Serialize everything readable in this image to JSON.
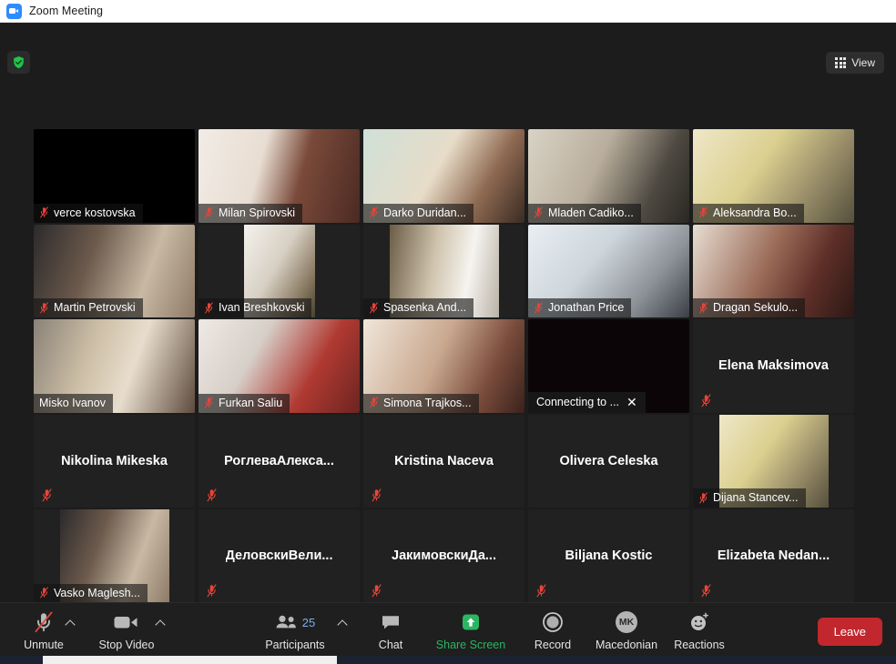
{
  "titlebar": {
    "title": "Zoom Meeting",
    "icon": "zoom-logo-icon"
  },
  "header": {
    "shield_icon": "security-shield-icon",
    "view_button": {
      "label": "View",
      "icon": "grid-view-icon"
    }
  },
  "gallery": {
    "tiles": [
      {
        "name": "verce kostovska",
        "style": "nameplate",
        "muted": true,
        "video": "off-black",
        "media": "full"
      },
      {
        "name": "Milan Spirovski",
        "style": "nameplate",
        "muted": true,
        "video": "on",
        "media": "full"
      },
      {
        "name": "Darko Duridan...",
        "style": "nameplate",
        "muted": true,
        "video": "on",
        "media": "full"
      },
      {
        "name": "Mladen Cadiko...",
        "style": "nameplate",
        "muted": true,
        "video": "on",
        "media": "full"
      },
      {
        "name": "Aleksandra Bo...",
        "style": "nameplate",
        "muted": true,
        "video": "on",
        "media": "full"
      },
      {
        "name": "Martin Petrovski",
        "style": "nameplate",
        "muted": true,
        "video": "on",
        "media": "full"
      },
      {
        "name": "Ivan Breshkovski",
        "style": "nameplate",
        "muted": true,
        "video": "on",
        "media": "narrow"
      },
      {
        "name": "Spasenka And...",
        "style": "nameplate",
        "muted": true,
        "video": "on",
        "media": "narrow-wide"
      },
      {
        "name": "Jonathan Price",
        "style": "nameplate",
        "muted": true,
        "video": "on",
        "media": "full"
      },
      {
        "name": "Dragan Sekulo...",
        "style": "nameplate",
        "muted": true,
        "video": "on",
        "media": "full"
      },
      {
        "name": "Misko Ivanov",
        "style": "nameplate",
        "muted": false,
        "video": "on",
        "media": "full",
        "active_speaker": true
      },
      {
        "name": "Furkan Saliu",
        "style": "nameplate",
        "muted": true,
        "video": "on",
        "media": "full"
      },
      {
        "name": "Simona Trajkos...",
        "style": "nameplate",
        "muted": true,
        "video": "on",
        "media": "full"
      },
      {
        "name": "Connecting to ...",
        "style": "connecting",
        "muted": false,
        "video": "off-black",
        "media": "full",
        "close_icon": "close-icon"
      },
      {
        "name": "Elena Maksimova",
        "style": "centered",
        "muted": true,
        "video": "off"
      },
      {
        "name": "Nikolina Mikeska",
        "style": "centered",
        "muted": true,
        "video": "off"
      },
      {
        "name": "РоглеваАлекса...",
        "style": "centered",
        "muted": true,
        "video": "off"
      },
      {
        "name": "Kristina Naceva",
        "style": "centered",
        "muted": true,
        "video": "off"
      },
      {
        "name": "Olivera Celeska",
        "style": "centered",
        "muted": false,
        "video": "off"
      },
      {
        "name": "Dijana Stancev...",
        "style": "nameplate",
        "muted": true,
        "video": "on",
        "media": "narrow-wide"
      },
      {
        "name": "Vasko Maglesh...",
        "style": "nameplate",
        "muted": true,
        "video": "on",
        "media": "narrow-wide"
      },
      {
        "name": "ДеловскиВели...",
        "style": "centered",
        "muted": true,
        "video": "off"
      },
      {
        "name": "ЈакимовскиДа...",
        "style": "centered",
        "muted": true,
        "video": "off"
      },
      {
        "name": "Biljana Kostic",
        "style": "centered",
        "muted": true,
        "video": "off"
      },
      {
        "name": "Elizabeta  Nedan...",
        "style": "centered",
        "muted": true,
        "video": "off"
      }
    ]
  },
  "toolbar": {
    "unmute": {
      "label": "Unmute",
      "icon": "microphone-muted-icon"
    },
    "stop_video": {
      "label": "Stop Video",
      "icon": "video-camera-icon"
    },
    "participants": {
      "label": "Participants",
      "count": "25",
      "icon": "participants-icon"
    },
    "chat": {
      "label": "Chat",
      "icon": "chat-bubble-icon"
    },
    "share_screen": {
      "label": "Share Screen",
      "icon": "share-screen-icon"
    },
    "record": {
      "label": "Record",
      "icon": "record-circle-icon"
    },
    "interpretation": {
      "label": "Macedonian",
      "badge": "MK"
    },
    "reactions": {
      "label": "Reactions",
      "icon": "reactions-smiley-icon"
    },
    "leave": {
      "label": "Leave"
    }
  },
  "colors": {
    "accent_green": "#2bb563",
    "leave_red": "#c1272d",
    "active_speaker_border": "#e8ea4f",
    "mute_red": "#e8443a",
    "count_blue": "#7fb0e8"
  }
}
